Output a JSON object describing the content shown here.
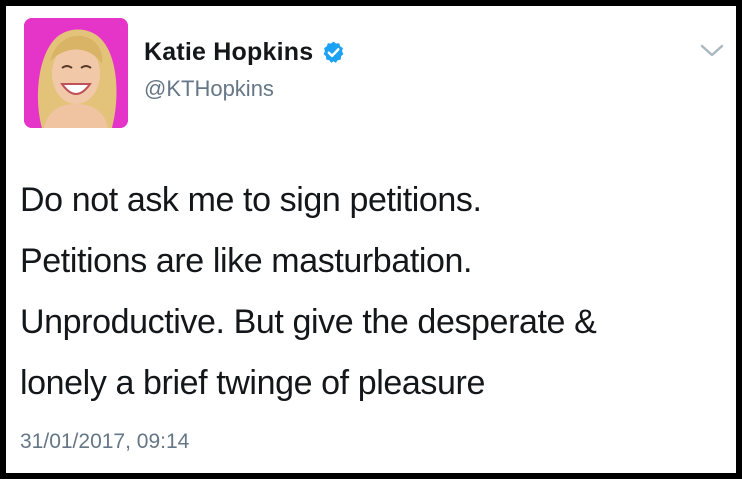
{
  "tweet": {
    "author": {
      "display_name": "Katie Hopkins",
      "handle": "@KTHopkins",
      "verified": true,
      "avatar_bg_color": "#e535c8"
    },
    "lines": [
      "Do not ask me to sign petitions.",
      "Petitions are like masturbation.",
      "Unproductive. But give the desperate &",
      "lonely a brief twinge of pleasure"
    ],
    "timestamp": "31/01/2017, 09:14",
    "icons": {
      "verified": "verified-badge-icon",
      "menu": "chevron-down-icon"
    },
    "colors": {
      "verified_blue": "#1da1f2",
      "text": "#14171a",
      "muted": "#657786"
    }
  }
}
